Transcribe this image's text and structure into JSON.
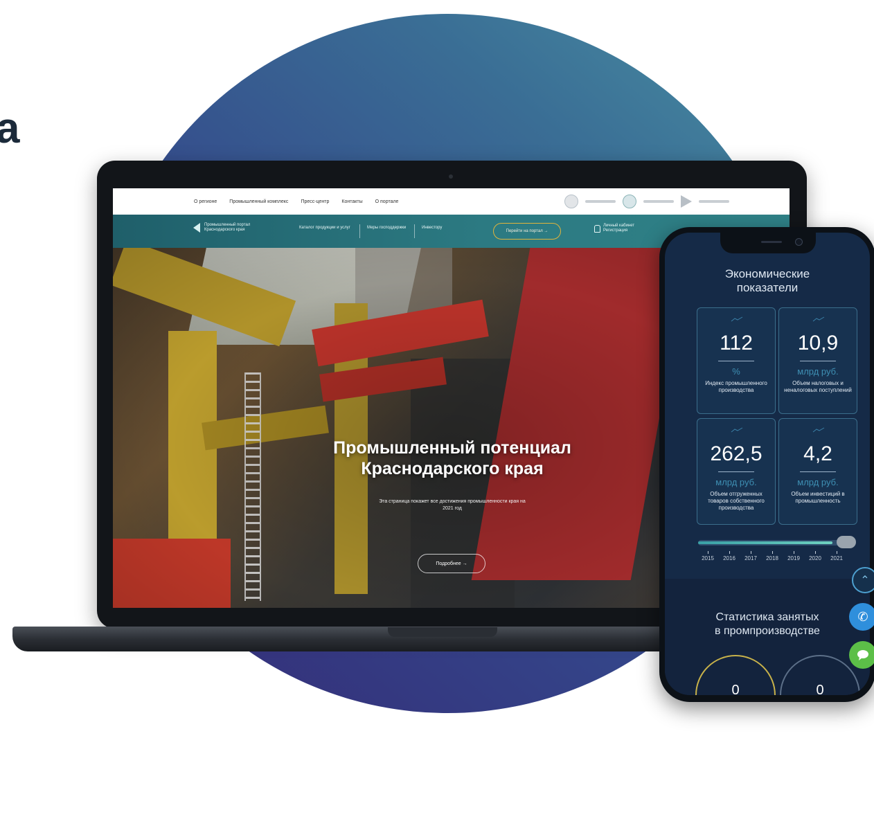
{
  "corner_text": "а",
  "laptop": {
    "topnav": [
      "О регионе",
      "Промышленный комплекс",
      "Пресс-центр",
      "Контакты",
      "О портале"
    ],
    "logo_text": "Промышленный портал Краснодарского края",
    "nav": {
      "catalog": "Каталог продукции и услуг",
      "support": "Меры господдержки",
      "investor": "Инвестору",
      "portal_button": "Перейти на портал →",
      "cabinet": "Личный кабинет",
      "register": "Регистрация"
    },
    "hero": {
      "title_line1": "Промышленный потенциал",
      "title_line2": "Краснодарского края",
      "subtitle": "Эта страница покажет все достижения промышленности края на 2021 год",
      "more_button": "Подробнее →"
    }
  },
  "phone": {
    "title_line1": "Экономические",
    "title_line2": "показатели",
    "cards": [
      {
        "value": "112",
        "unit": "%",
        "desc": "Индекс промышленного производства"
      },
      {
        "value": "10,9",
        "unit": "млрд руб.",
        "desc": "Объем налоговых и неналоговых поступлений"
      },
      {
        "value": "262,5",
        "unit": "млрд руб.",
        "desc": "Объем отгруженных товаров собственного производства"
      },
      {
        "value": "4,2",
        "unit": "млрд руб.",
        "desc": "Объем инвестиций в промышленность"
      }
    ],
    "years": [
      "2015",
      "2016",
      "2017",
      "2018",
      "2019",
      "2020",
      "2021"
    ],
    "selected_year": "2021",
    "subtitle_line1": "Статистика занятых",
    "subtitle_line2": "в промпроизводстве",
    "donut_values": [
      "0",
      "0"
    ]
  },
  "colors": {
    "circle_start": "#352a76",
    "circle_end": "#4a90a3",
    "navbar": "#2c7a82",
    "phone_bg": "#152a47",
    "card_border": "#3b6e8c",
    "unit_accent": "#3e8fb3",
    "chat_fab": "#5cbf48",
    "call_fab": "#2f8fdc"
  },
  "icons": {
    "up": "chevron-up-icon",
    "call": "phone-icon",
    "chat": "chat-icon"
  }
}
